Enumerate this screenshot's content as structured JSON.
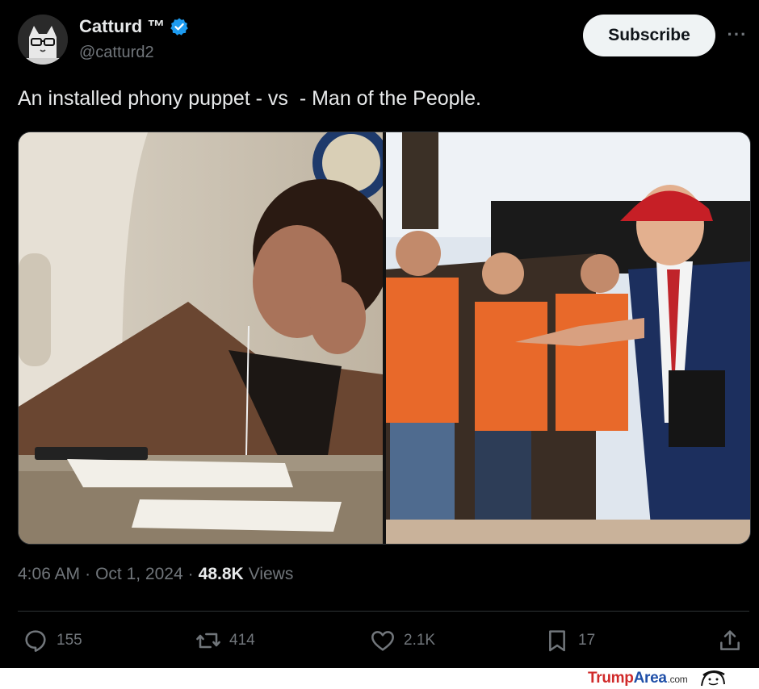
{
  "author": {
    "display_name": "Catturd ™",
    "handle": "@catturd2",
    "verified": true
  },
  "subscribe_label": "Subscribe",
  "more_label": "···",
  "tweet_text": "An installed phony puppet - vs  - Man of the People.",
  "meta": {
    "time": "4:06 AM",
    "dot1": "·",
    "date": "Oct 1, 2024",
    "dot2": "·",
    "views_count": "48.8K",
    "views_label": "Views"
  },
  "actions": {
    "replies": "155",
    "reposts": "414",
    "likes": "2.1K",
    "bookmarks": "17"
  },
  "watermark": {
    "part1": "Trump",
    "part2": "Area",
    "suffix": ".com"
  },
  "colors": {
    "background": "#000000",
    "text_primary": "#e7e9ea",
    "text_secondary": "#71767b",
    "verified_blue": "#1d9bf0",
    "subscribe_bg": "#eff3f4"
  }
}
